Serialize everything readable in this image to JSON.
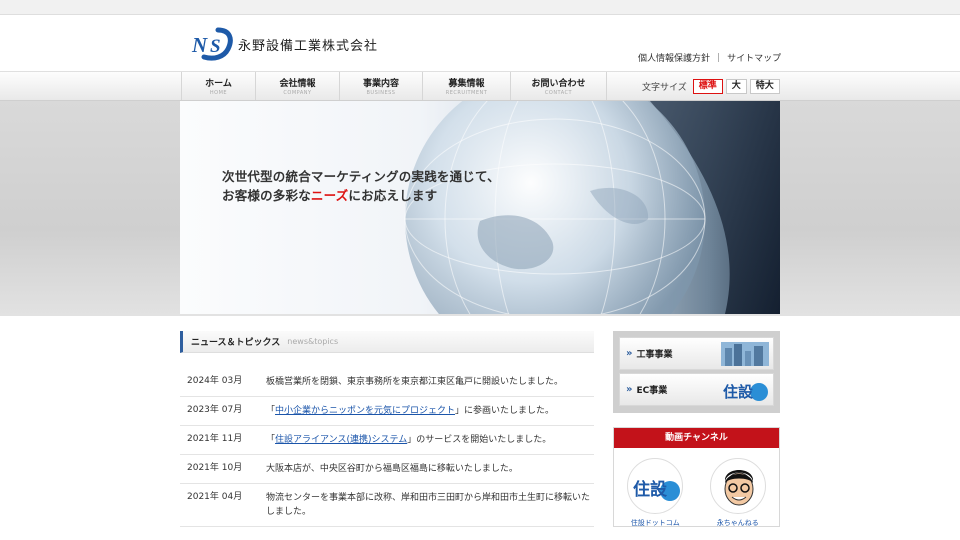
{
  "company": {
    "name": "永野設備工業株式会社",
    "logo_letters": "NS",
    "brand_color": "#1e5aa8"
  },
  "util_links": [
    {
      "label": "個人情報保護方針"
    },
    {
      "label": "サイトマップ"
    }
  ],
  "util_separator": "|",
  "nav": [
    {
      "label": "ホーム",
      "sub": "HOME"
    },
    {
      "label": "会社情報",
      "sub": "COMPANY"
    },
    {
      "label": "事業内容",
      "sub": "BUSINESS"
    },
    {
      "label": "募集情報",
      "sub": "RECRUITMENT"
    },
    {
      "label": "お問い合わせ",
      "sub": "CONTACT"
    }
  ],
  "font_size": {
    "label": "文字サイズ",
    "options": [
      "標準",
      "大",
      "特大"
    ],
    "selected": "標準",
    "accent_color": "#dd1111"
  },
  "hero": {
    "line1": "次世代型の統合マーケティングの実践を通じて、",
    "line2_pre": "お客様の多彩な",
    "line2_emph": "ニーズ",
    "line2_post": "にお応えします"
  },
  "news": {
    "title": "ニュース＆トピックス",
    "subtitle": "news&topics",
    "items": [
      {
        "date": "2024年 03月",
        "pre": "板橋営業所を閉鎖、東京事務所を東京都江東区亀戸に開設いたしました。",
        "link": "",
        "post": ""
      },
      {
        "date": "2023年 07月",
        "pre": "「",
        "link": "中小企業からニッポンを元気にプロジェクト",
        "post": "」に参画いたしました。"
      },
      {
        "date": "2021年 11月",
        "pre": "「",
        "link": "住設アライアンス(連携)システム",
        "post": "」のサービスを開始いたしました。"
      },
      {
        "date": "2021年 10月",
        "pre": "大阪本店が、中央区谷町から福島区福島に移転いたしました。",
        "link": "",
        "post": ""
      },
      {
        "date": "2021年 04月",
        "pre": "物流センターを事業本部に改称、岸和田市三田町から岸和田市土生町に移転いたしました。",
        "link": "",
        "post": ""
      }
    ]
  },
  "side_banners": [
    {
      "chevron": "»",
      "label": "工事事業"
    },
    {
      "chevron": "»",
      "label": "EC事業",
      "logo_text": "住設"
    }
  ],
  "video": {
    "title": "動画チャンネル",
    "channels": [
      {
        "logo_text": "住設",
        "caption": "住設ドットコム"
      },
      {
        "caption": "永ちゃんねる"
      }
    ]
  }
}
